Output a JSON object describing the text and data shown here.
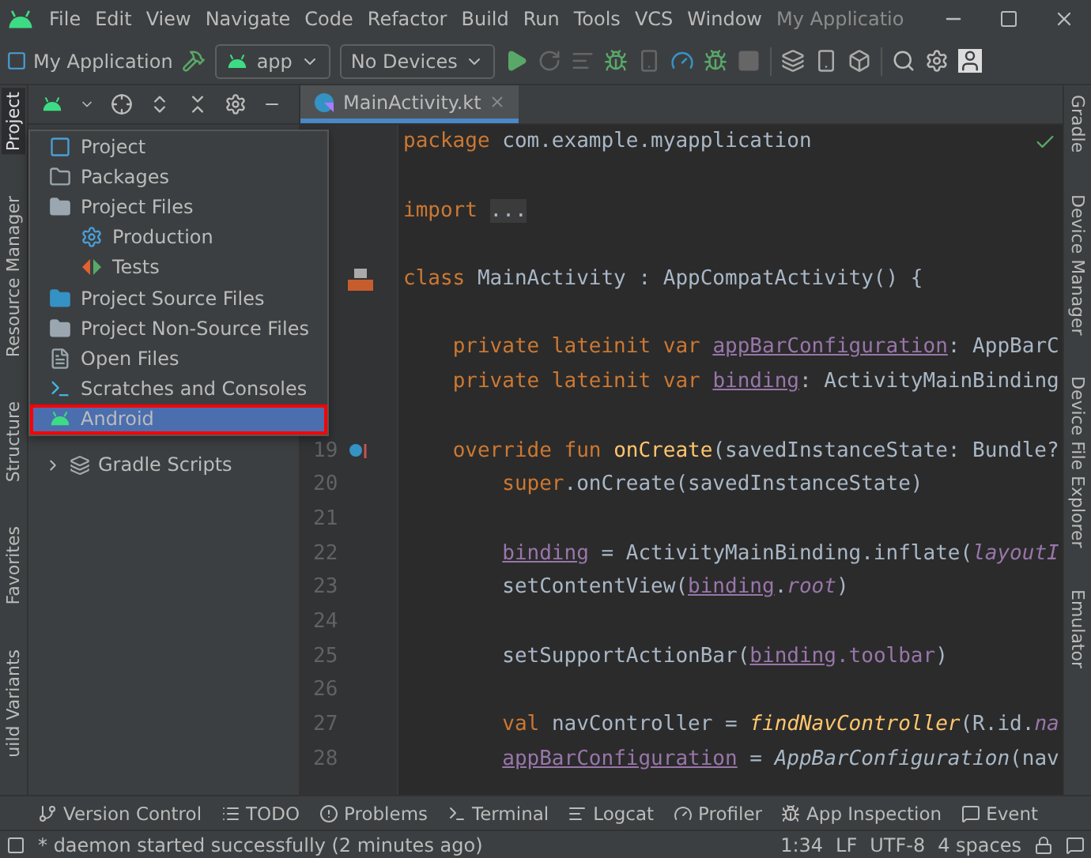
{
  "menu_bar": {
    "items": [
      "File",
      "Edit",
      "View",
      "Navigate",
      "Code",
      "Refactor",
      "Build",
      "Run",
      "Tools",
      "VCS",
      "Window"
    ],
    "title": "My Applicatio"
  },
  "toolbar": {
    "project": "My Application",
    "config": "app",
    "device": "No Devices"
  },
  "left_stripe": [
    {
      "label": "Project",
      "selected": true
    },
    {
      "label": "Resource Manager",
      "selected": false
    },
    {
      "label": "Structure",
      "selected": false
    },
    {
      "label": "Favorites",
      "selected": false
    },
    {
      "label": "uild Variants",
      "selected": false
    }
  ],
  "right_stripe": [
    "Gradle",
    "Device Manager",
    "Device File Explorer",
    "Emulator"
  ],
  "editor_tabs": [
    {
      "label": "MainActivity.kt",
      "selected": true
    }
  ],
  "view_popup": {
    "items": [
      {
        "label": "Project",
        "kind": "project",
        "selected": false
      },
      {
        "label": "Packages",
        "kind": "packages",
        "selected": false
      },
      {
        "label": "Project Files",
        "kind": "folder",
        "selected": false,
        "children": [
          {
            "label": "Production",
            "kind": "production",
            "selected": false
          },
          {
            "label": "Tests",
            "kind": "tests",
            "selected": false
          }
        ]
      },
      {
        "label": "Project Source Files",
        "kind": "source",
        "selected": false
      },
      {
        "label": "Project Non-Source Files",
        "kind": "nonsource",
        "selected": false
      },
      {
        "label": "Open Files",
        "kind": "file",
        "selected": false
      },
      {
        "label": "Scratches and Consoles",
        "kind": "scratch",
        "selected": false
      },
      {
        "label": "Android",
        "kind": "android",
        "selected": true
      }
    ]
  },
  "project_tree": [
    {
      "label": "Gradle Scripts",
      "expanded": false
    }
  ],
  "code_lines": [
    {
      "tokens": [
        {
          "kind": "keyword",
          "text": "package "
        },
        {
          "kind": "plain",
          "text": "com.example.myapplication"
        }
      ]
    },
    {
      "space_before": true,
      "tokens": [
        {
          "kind": "keyword",
          "text": "import "
        },
        {
          "kind": "fold",
          "text": "..."
        }
      ]
    },
    {
      "space_before": true,
      "gutter": {
        "kind": "layout"
      },
      "tokens": [
        {
          "kind": "keyword",
          "text": "class "
        },
        {
          "kind": "plain",
          "text": "MainActivity : AppCompatActivity() {"
        }
      ]
    },
    {
      "space_before": true,
      "tokens": [
        {
          "kind": "keyword",
          "text": "    private lateinit var "
        },
        {
          "kind": "prop",
          "text": "appBarConfiguration"
        },
        {
          "kind": "plain",
          "text": ": AppBarC"
        }
      ]
    },
    {
      "tokens": [
        {
          "kind": "keyword",
          "text": "    private lateinit var "
        },
        {
          "kind": "prop",
          "text": "binding"
        },
        {
          "kind": "plain",
          "text": ": ActivityMainBinding"
        }
      ]
    },
    {
      "space_before": true,
      "number": "19",
      "gutter": {
        "kind": "override"
      },
      "tokens": [
        {
          "kind": "keyword",
          "text": "    override fun "
        },
        {
          "kind": "fn",
          "text": "onCreate"
        },
        {
          "kind": "plain",
          "text": "(savedInstanceState: Bundle?"
        }
      ]
    },
    {
      "number": "20",
      "tokens": [
        {
          "kind": "keyword",
          "text": "        super"
        },
        {
          "kind": "plain",
          "text": ".onCreate(savedInstanceState)"
        }
      ]
    },
    {
      "number": "21"
    },
    {
      "number": "22",
      "tokens": [
        {
          "kind": "prop",
          "text": "        binding"
        },
        {
          "kind": "plain",
          "text": " = ActivityMainBinding.inflate("
        },
        {
          "kind": "italic-prop",
          "text": "layoutI"
        }
      ]
    },
    {
      "number": "23",
      "tokens": [
        {
          "kind": "plain",
          "text": "        setContentView("
        },
        {
          "kind": "prop",
          "text": "binding"
        },
        {
          "kind": "plain",
          "text": "."
        },
        {
          "kind": "italic-prop",
          "text": "root"
        },
        {
          "kind": "plain",
          "text": ")"
        }
      ]
    },
    {
      "number": "24"
    },
    {
      "number": "25",
      "tokens": [
        {
          "kind": "plain",
          "text": "        setSupportActionBar("
        },
        {
          "kind": "prop",
          "text": "binding"
        },
        {
          "kind": "field",
          "text": ".toolbar"
        },
        {
          "kind": "plain",
          "text": ")"
        }
      ]
    },
    {
      "number": "26"
    },
    {
      "number": "27",
      "tokens": [
        {
          "kind": "keyword",
          "text": "        val "
        },
        {
          "kind": "plain",
          "text": "navController = "
        },
        {
          "kind": "italic-fn",
          "text": "findNavController"
        },
        {
          "kind": "plain",
          "text": "(R.id."
        },
        {
          "kind": "italic-prop",
          "text": "na"
        }
      ]
    },
    {
      "number": "28",
      "tokens": [
        {
          "kind": "prop",
          "text": "        appBarConfiguration"
        },
        {
          "kind": "plain",
          "text": " = "
        },
        {
          "kind": "italic-plain",
          "text": "AppBarConfiguration"
        },
        {
          "kind": "plain",
          "text": "(nav"
        }
      ]
    }
  ],
  "tool_windows": [
    "Version Control",
    "TODO",
    "Problems",
    "Terminal",
    "Logcat",
    "Profiler",
    "App Inspection",
    "Event"
  ],
  "status_bar": {
    "message": "* daemon started successfully (2 minutes ago)",
    "items": [
      "1:34",
      "LF",
      "UTF-8",
      "4 spaces"
    ]
  }
}
